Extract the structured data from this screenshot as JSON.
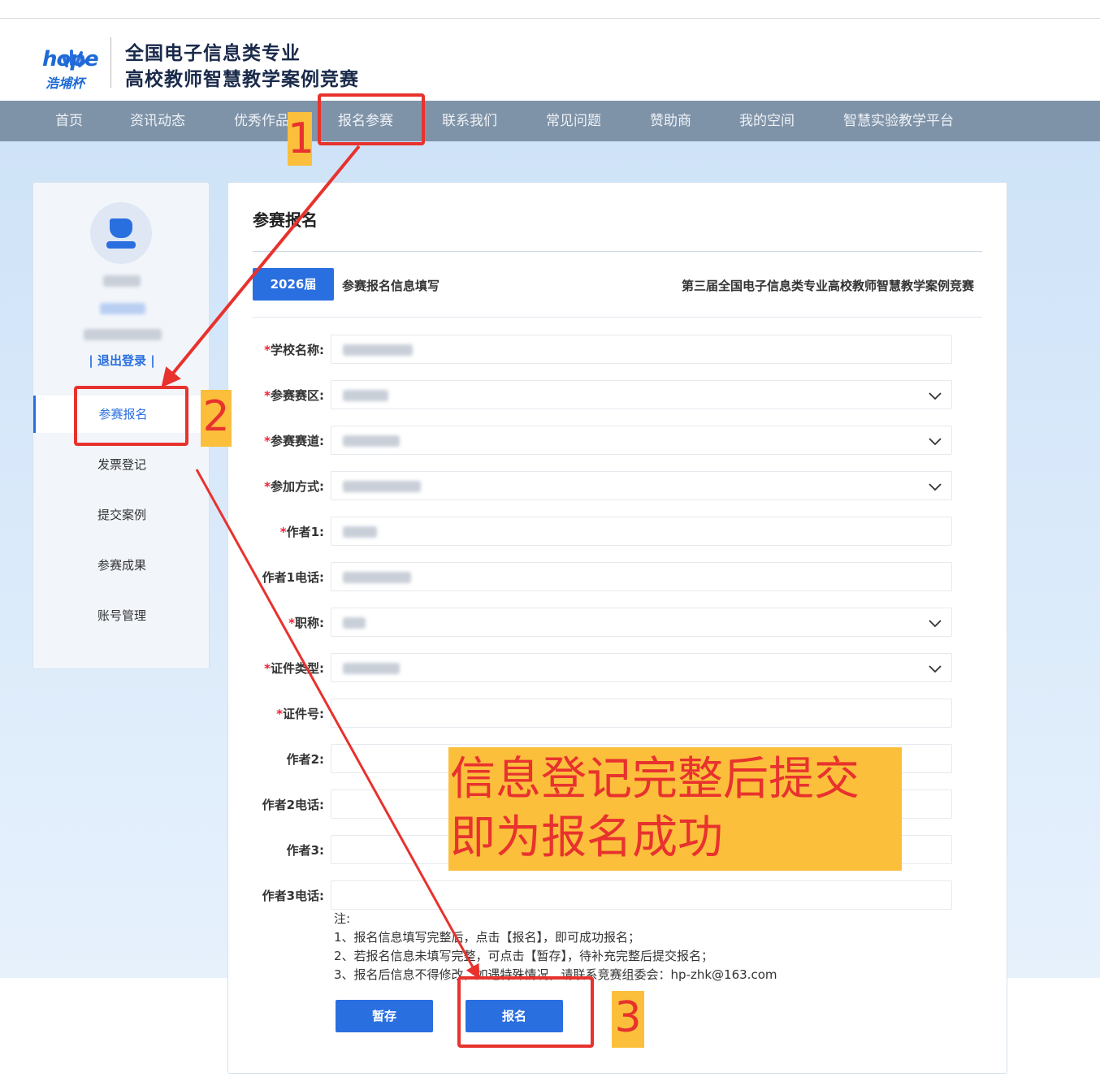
{
  "header": {
    "logo_text": "hope",
    "logo_sub": "浩埔杯",
    "title_line1": "全国电子信息类专业",
    "title_line2": "高校教师智慧教学案例竞赛"
  },
  "nav": {
    "items": [
      {
        "label": "首页"
      },
      {
        "label": "资讯动态"
      },
      {
        "label": "优秀作品"
      },
      {
        "label": "报名参赛"
      },
      {
        "label": "联系我们"
      },
      {
        "label": "常见问题"
      },
      {
        "label": "赞助商"
      },
      {
        "label": "我的空间"
      },
      {
        "label": "智慧实验教学平台"
      }
    ]
  },
  "sidebar": {
    "logout": "| 退出登录 |",
    "menu": [
      {
        "label": "参赛报名"
      },
      {
        "label": "发票登记"
      },
      {
        "label": "提交案例"
      },
      {
        "label": "参赛成果"
      },
      {
        "label": "账号管理"
      }
    ]
  },
  "panel": {
    "title": "参赛报名",
    "year_tab": "2026届",
    "sub_title": "参赛报名信息填写",
    "competition": "第三届全国电子信息类专业高校教师智慧教学案例竞赛"
  },
  "form": {
    "fields": [
      {
        "label": "学校名称:",
        "required": "*"
      },
      {
        "label": "参赛赛区:",
        "required": "*"
      },
      {
        "label": "参赛赛道:",
        "required": "*"
      },
      {
        "label": "参加方式:",
        "required": "*"
      },
      {
        "label": "作者1:",
        "required": "*"
      },
      {
        "label": "作者1电话:",
        "required": ""
      },
      {
        "label": "职称:",
        "required": "*"
      },
      {
        "label": "证件类型:",
        "required": "*"
      },
      {
        "label": "证件号:",
        "required": "*"
      },
      {
        "label": "作者2:",
        "required": ""
      },
      {
        "label": "作者2电话:",
        "required": ""
      },
      {
        "label": "作者3:",
        "required": ""
      },
      {
        "label": "作者3电话:",
        "required": ""
      }
    ]
  },
  "notes": {
    "heading": "注:",
    "line1": "1、报名信息填写完整后，点击【报名】，即可成功报名；",
    "line2": "2、若报名信息未填写完整，可点击【暂存】，待补充完整后提交报名；",
    "line3": "3、报名后信息不得修改，如遇特殊情况，请联系竞赛组委会：hp-zhk@163.com"
  },
  "buttons": {
    "save": "暂存",
    "submit": "报名"
  },
  "annotations": {
    "step1": "1",
    "step2": "2",
    "step3": "3",
    "callout_line1": "信息登记完整后提交",
    "callout_line2": "即为报名成功"
  },
  "colors": {
    "accent": "#2a6fe0",
    "nav_bg": "#7f93a8",
    "annotation_red": "#e8322e",
    "annotation_yellow": "#fbbf3c"
  }
}
